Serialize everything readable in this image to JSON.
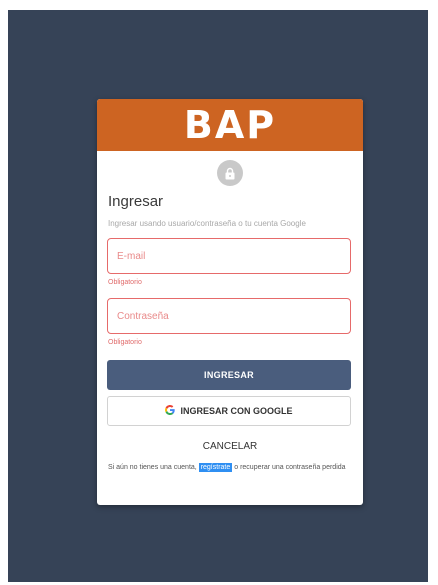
{
  "brand": {
    "logo": "BAP",
    "color": "#cd6422"
  },
  "icons": {
    "lock": "lock-icon",
    "google": "google-g-icon"
  },
  "login": {
    "title": "Ingresar",
    "subtitle": "Ingresar usando usuario/contraseña o tu cuenta Google",
    "email": {
      "placeholder": "E-mail",
      "value": "",
      "error": "Obligatorio"
    },
    "password": {
      "placeholder": "Contraseña",
      "value": "",
      "error": "Obligatorio"
    },
    "submit_label": "INGRESAR",
    "google_label": "INGRESAR CON GOOGLE",
    "cancel_label": "CANCELAR",
    "footer": {
      "prefix": "Si aún no tienes una cuenta,",
      "register_link": "regístrate",
      "middle": "o",
      "recover_link": "recuperar una contraseña perdida"
    }
  },
  "colors": {
    "background": "#364357",
    "primary_button": "#4a5d7d",
    "error": "#e66a6a",
    "link_highlight": "#2f8ff2"
  }
}
